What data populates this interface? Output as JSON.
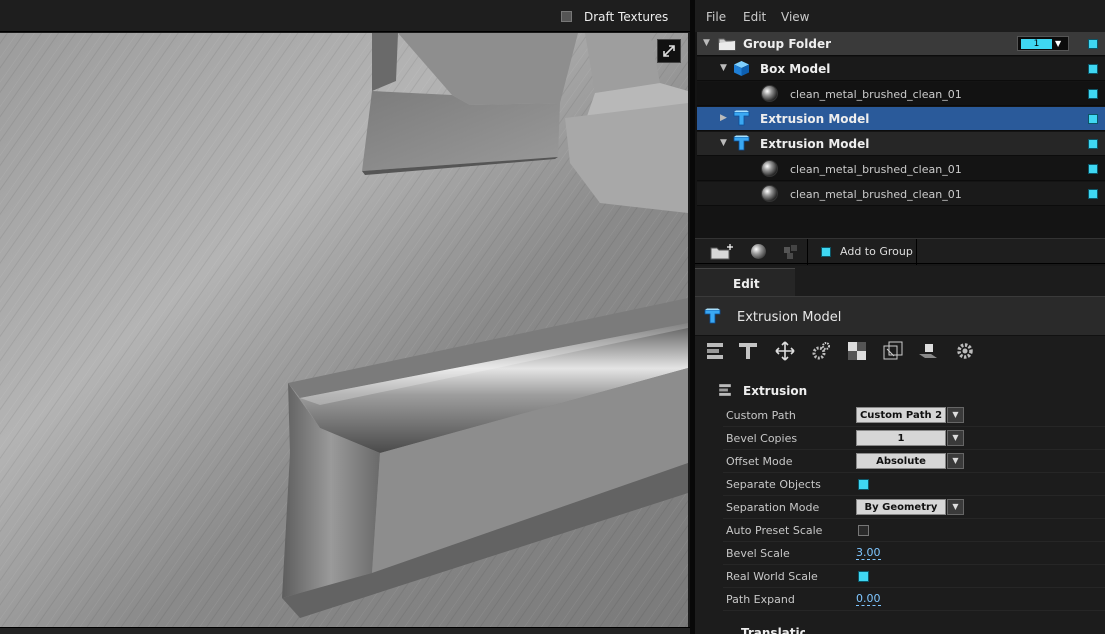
{
  "viewport": {
    "draft_textures_label": "Draft Textures",
    "draft_textures_checked": false
  },
  "menu": [
    "File",
    "Edit",
    "View"
  ],
  "tree": {
    "group_folder": {
      "label": "Group Folder",
      "count": "1"
    },
    "items": [
      {
        "label": "Box Model",
        "kind": "box",
        "expanded": true
      },
      {
        "label": "clean_metal_brushed_clean_01",
        "kind": "material"
      },
      {
        "label": "Extrusion Model",
        "kind": "extrusion",
        "expanded": false,
        "selected": true
      },
      {
        "label": "Extrusion Model",
        "kind": "extrusion",
        "expanded": true
      },
      {
        "label": "clean_metal_brushed_clean_01",
        "kind": "material"
      },
      {
        "label": "clean_metal_brushed_clean_01",
        "kind": "material"
      }
    ],
    "add_to_group_label": "Add to Group"
  },
  "props": {
    "tab_label": "Edit",
    "object_title": "Extrusion Model",
    "section_title": "Extrusion",
    "rows": [
      {
        "label": "Custom Path",
        "type": "dropdown",
        "value": "Custom Path 2"
      },
      {
        "label": "Bevel Copies",
        "type": "dropdown",
        "value": "1"
      },
      {
        "label": "Offset Mode",
        "type": "dropdown",
        "value": "Absolute"
      },
      {
        "label": "Separate Objects",
        "type": "checkbox",
        "value": true
      },
      {
        "label": "Separation Mode",
        "type": "dropdown",
        "value": "By Geometry"
      },
      {
        "label": "Auto Preset Scale",
        "type": "checkbox",
        "value": false
      },
      {
        "label": "Bevel Scale",
        "type": "number",
        "value": "3.00"
      },
      {
        "label": "Real World Scale",
        "type": "checkbox",
        "value": true
      },
      {
        "label": "Path Expand",
        "type": "number",
        "value": "0.00"
      }
    ],
    "next_section_title": "Translation"
  },
  "colors": {
    "accent": "#3fd7f2",
    "selection": "#2a5a9a",
    "panel": "#1c1c1c"
  }
}
